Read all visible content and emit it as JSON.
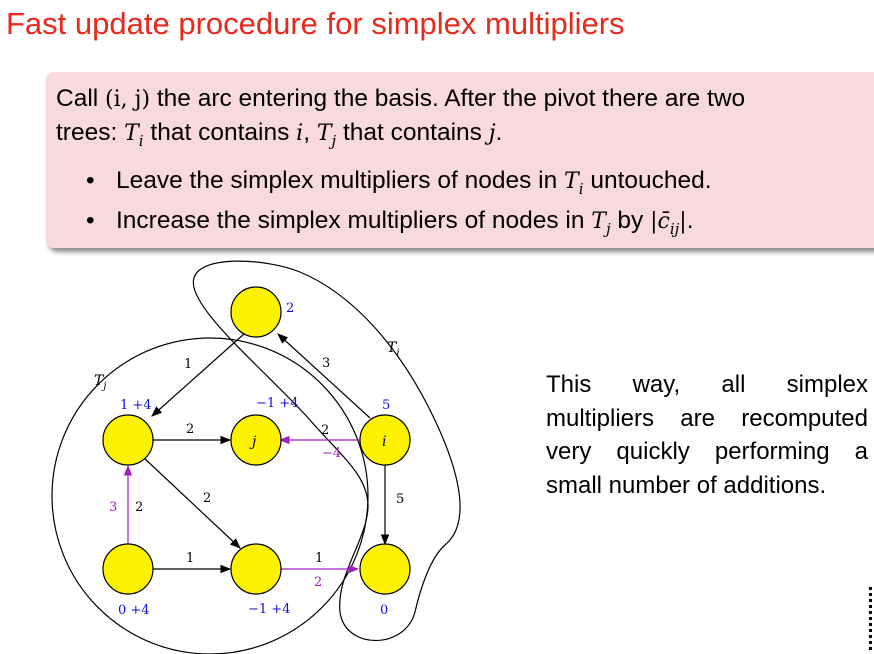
{
  "title": "Fast update procedure for simplex multipliers",
  "box": {
    "line1_pre": "Call ",
    "line1_math": "(i, j)",
    "line1_post": " the arc entering the basis. After the pivot there are two",
    "line2_a": "trees: ",
    "line2_t": "T",
    "line2_ti_sub": "i",
    "line2_b": " that contains ",
    "line2_i": "i",
    "line2_c": ", ",
    "line2_tj_sub": "j",
    "line2_d": " that contains ",
    "line2_j": "j",
    "line2_e": ".",
    "bullet1_pre": "Leave the simplex multipliers of nodes in ",
    "bullet1_post": " untouched.",
    "bullet2_pre": "Increase the simplex multipliers of nodes in ",
    "bullet2_mid": " by ",
    "bullet2_expr": "|c̄",
    "bullet2_sub": "ij",
    "bullet2_close": "|",
    "bullet2_post": "."
  },
  "side_text": "This way, all simplex multipliers are recomputed very quickly performing a small number of additions.",
  "diagram": {
    "node_fill": "#fff200",
    "blue": "#0a10e0",
    "purple": "#a020c0",
    "tree_i_label": "T",
    "tree_i_sub": "i",
    "tree_j_label": "T",
    "tree_j_sub": "j",
    "node_j_label": "j",
    "node_i_label": "i",
    "mult_top": "2",
    "mult_topleft": "1 +4",
    "mult_j": "−1 +4",
    "mult_i": "5",
    "mult_botleft": "0 +4",
    "mult_botmid": "−1 +4",
    "mult_botright": "0",
    "arc_top_to_topleft": "1",
    "arc_i_to_top": "3",
    "arc_topleft_to_j": "2",
    "arc_i_to_j_cost": "2",
    "arc_i_to_j_reduced": "−4",
    "arc_topleft_to_botmid": "2",
    "arc_vertical_left_reduced": "3",
    "arc_vertical_left_cost": "2",
    "arc_bottom_left": "1",
    "arc_bottom_right_cost": "1",
    "arc_bottom_right_reduced": "2",
    "arc_i_to_botright": "5"
  }
}
